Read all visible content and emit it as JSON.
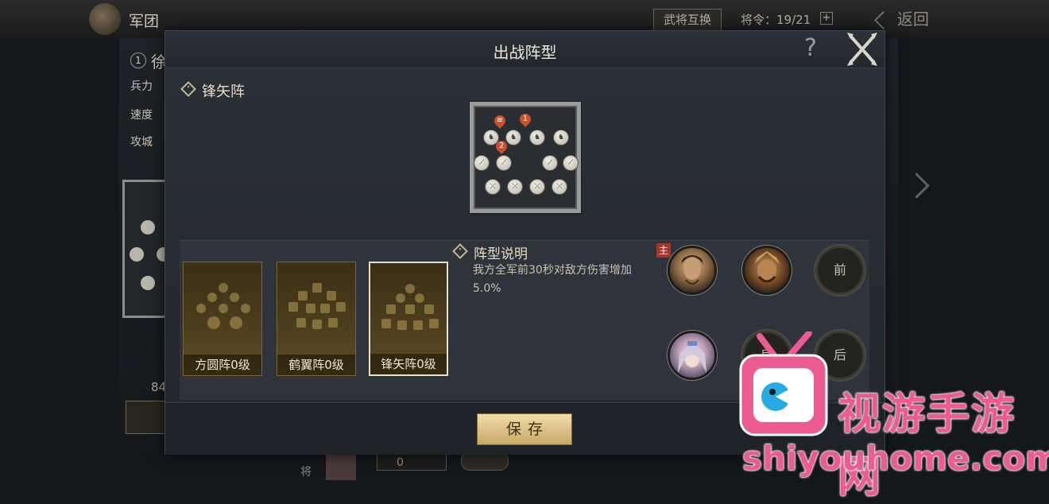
{
  "background": {
    "title": "军团",
    "swap_button": "武将互换",
    "orders_label": "将令：19/21",
    "plus": "+",
    "back_label": "返回",
    "general": {
      "rank": "1",
      "name": "徐"
    },
    "stats": [
      "兵力",
      "速度",
      "攻城"
    ],
    "count": "84",
    "bottom_label": "将",
    "bottom_value": "0"
  },
  "modal": {
    "title": "出战阵型",
    "help": "?",
    "formation_name": "锋矢阵",
    "board": {
      "markers": [
        "1",
        "2"
      ],
      "glyphs": {
        "cavalry": "♞",
        "spear": "⟋",
        "archer": "⤫"
      }
    },
    "cards": [
      {
        "label": "方圆阵0级",
        "selected": false
      },
      {
        "label": "鹤翼阵0级",
        "selected": false
      },
      {
        "label": "锋矢阵0级",
        "selected": true
      }
    ],
    "description": {
      "title": "阵型说明",
      "text": "我方全军前30秒对敌方伤害增加",
      "value": "5.0%"
    },
    "lord_badge": "主",
    "slots": {
      "front": "前",
      "mid": "后",
      "back": "后"
    },
    "save": "保存"
  },
  "watermark": {
    "brand": "视游手游网",
    "url": "shiyouhome.com"
  },
  "colors": {
    "accent": "#c8b98f",
    "save": "#e2c888",
    "marker": "#c5512e",
    "watermark": "#ec5b91"
  }
}
